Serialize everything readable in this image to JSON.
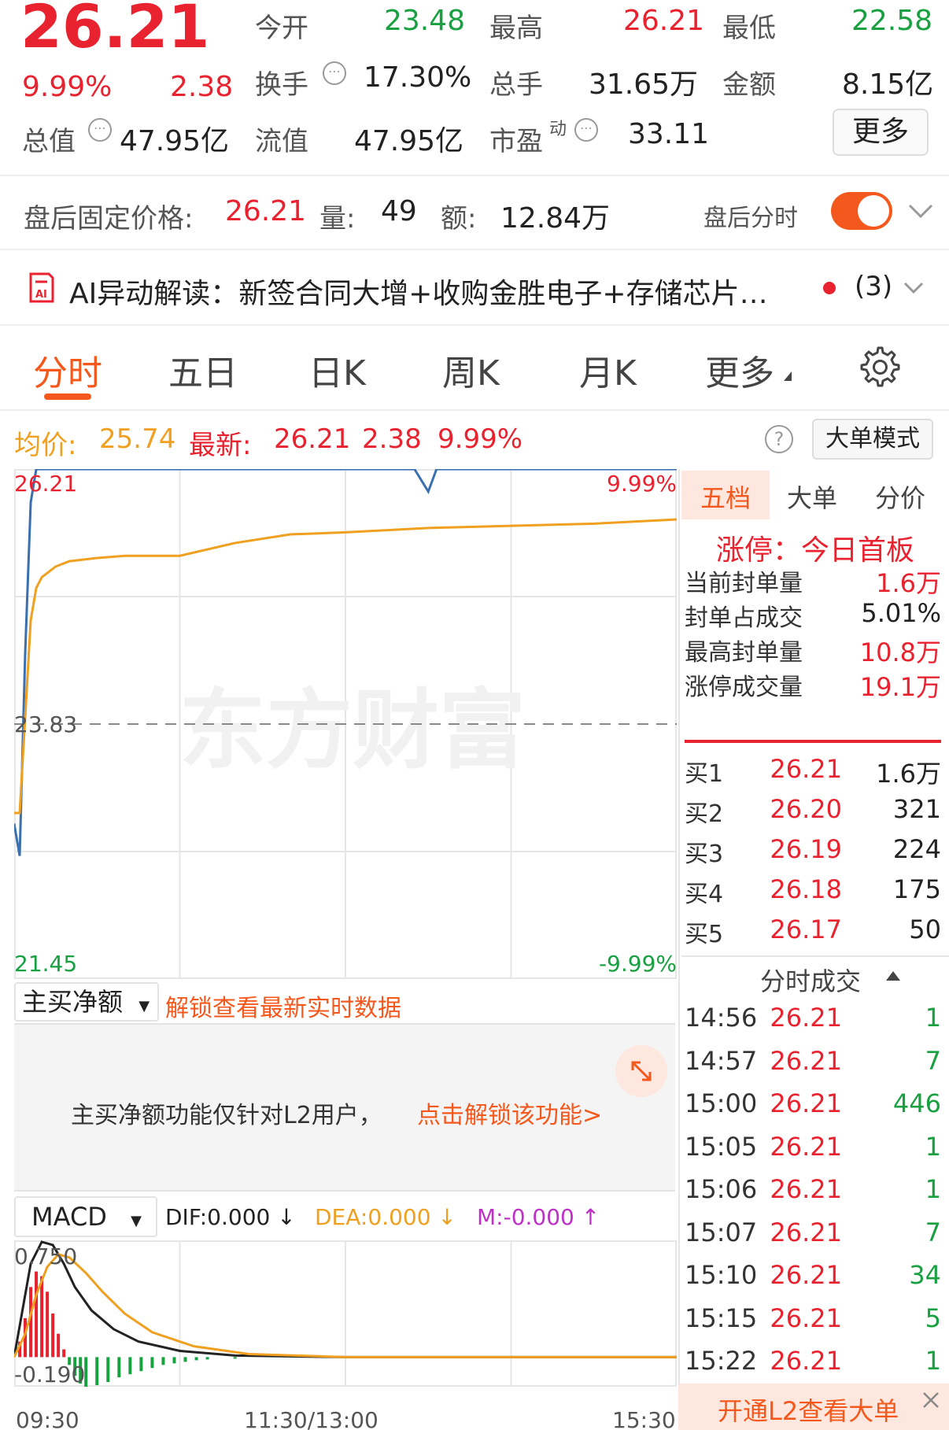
{
  "quote": {
    "price": "26.21",
    "change_pct": "9.99%",
    "change": "2.38",
    "open_label": "今开",
    "open": "23.48",
    "high_label": "最高",
    "high": "26.21",
    "low_label": "最低",
    "low": "22.58",
    "turnover_label": "换手",
    "turnover": "17.30%",
    "volume_label": "总手",
    "volume": "31.65万",
    "amount_label": "金额",
    "amount": "8.15亿",
    "total_cap_label": "总值",
    "total_cap": "47.95亿",
    "float_cap_label": "流值",
    "float_cap": "47.95亿",
    "pe_label": "市盈",
    "pe_sup": "动",
    "pe": "33.11",
    "more_label": "更多"
  },
  "after_hours": {
    "price_label": "盘后固定价格:",
    "price": "26.21",
    "vol_label": "量:",
    "vol": "49",
    "amt_label": "额:",
    "amt": "12.84万",
    "toggle_label": "盘后分时",
    "toggle_on": true
  },
  "ai": {
    "text": "AI异动解读：新签合同大增+收购金胜电子+存储芯片…",
    "count": "(3)"
  },
  "tabs": [
    "分时",
    "五日",
    "日K",
    "周K",
    "月K",
    "更多"
  ],
  "info_bar": {
    "avg_label": "均价:",
    "avg": "25.74",
    "latest_label": "最新:",
    "latest": "26.21",
    "change": "2.38",
    "change_pct": "9.99%",
    "help": "?",
    "mode_button": "大单模式"
  },
  "chart_labels": {
    "top_price": "26.21",
    "top_pct": "9.99%",
    "mid_price": "23.83",
    "bottom_price": "21.45",
    "bottom_pct": "-9.99%",
    "watermark": "东方财富"
  },
  "chart_data": [
    {
      "type": "line",
      "ylim": [
        21.45,
        26.21
      ],
      "reference": 23.83,
      "series": [
        {
          "color": "#3a6fb0",
          "x": [
            0,
            2,
            4,
            6,
            8,
            10,
            40,
            145,
            150,
            153,
            156,
            240
          ],
          "y": [
            22.9,
            22.6,
            24.5,
            25.9,
            26.21,
            26.21,
            26.21,
            26.21,
            26.0,
            26.21,
            26.21,
            26.21
          ]
        },
        {
          "color": "#f0a020",
          "x": [
            0,
            2,
            4,
            6,
            8,
            10,
            15,
            20,
            30,
            40,
            60,
            80,
            100,
            120,
            150,
            180,
            210,
            240
          ],
          "y": [
            23.0,
            23.0,
            23.9,
            24.8,
            25.1,
            25.2,
            25.3,
            25.35,
            25.38,
            25.4,
            25.4,
            25.52,
            25.6,
            25.62,
            25.66,
            25.68,
            25.7,
            25.74
          ]
        }
      ]
    },
    {
      "type": "line",
      "ylim": [
        -0.19,
        0.75
      ],
      "series": [
        {
          "name": "DIF",
          "color": "#222222",
          "x": [
            0,
            3,
            6,
            10,
            14,
            18,
            22,
            28,
            36,
            45,
            60,
            80,
            120,
            240
          ],
          "y": [
            0,
            0.3,
            0.6,
            0.74,
            0.72,
            0.6,
            0.45,
            0.3,
            0.18,
            0.1,
            0.04,
            0.01,
            0,
            0
          ]
        },
        {
          "name": "DEA",
          "color": "#f0a020",
          "x": [
            0,
            4,
            8,
            12,
            16,
            20,
            26,
            32,
            40,
            50,
            65,
            85,
            120,
            240
          ],
          "y": [
            0,
            0.15,
            0.4,
            0.58,
            0.66,
            0.64,
            0.54,
            0.42,
            0.28,
            0.16,
            0.07,
            0.02,
            0,
            0
          ]
        },
        {
          "name": "M",
          "type": "bar",
          "x": [
            2,
            4,
            6,
            8,
            10,
            12,
            14,
            16,
            18,
            20,
            22,
            24,
            26,
            30,
            34,
            38,
            42,
            46,
            50,
            54,
            58,
            62,
            66,
            70,
            80
          ],
          "y": [
            0.1,
            0.25,
            0.45,
            0.55,
            0.52,
            0.42,
            0.28,
            0.15,
            0.05,
            -0.05,
            -0.12,
            -0.17,
            -0.19,
            -0.18,
            -0.16,
            -0.13,
            -0.11,
            -0.09,
            -0.07,
            -0.05,
            -0.04,
            -0.03,
            -0.02,
            -0.015,
            -0.01
          ]
        }
      ]
    }
  ],
  "macd_labels": {
    "top": "0.750",
    "bottom": "-0.190",
    "select": "MACD",
    "dif": "DIF:0.000 ↓",
    "dea": "DEA:0.000 ↓",
    "m": "M:-0.000 ↑",
    "x_start": "09:30",
    "x_mid": "11:30/13:00",
    "x_end": "15:30"
  },
  "netbuy": {
    "select": "主买净额",
    "unlock_tip": "解锁查看最新实时数据",
    "msg": "主买净额功能仅针对L2用户，",
    "link": "点击解锁该功能>"
  },
  "side_tabs": [
    "五档",
    "大单",
    "分价"
  ],
  "limit_up": {
    "title": "涨停：今日首板",
    "rows": [
      {
        "label": "当前封单量",
        "value": "1.6万",
        "color": "#e8222e"
      },
      {
        "label": "封单占成交",
        "value": "5.01%",
        "color": "#222222"
      },
      {
        "label": "最高封单量",
        "value": "10.8万",
        "color": "#e8222e"
      },
      {
        "label": "涨停成交量",
        "value": "19.1万",
        "color": "#e8222e"
      }
    ]
  },
  "bids": [
    {
      "label": "买1",
      "price": "26.21",
      "vol": "1.6万"
    },
    {
      "label": "买2",
      "price": "26.20",
      "vol": "321"
    },
    {
      "label": "买3",
      "price": "26.19",
      "vol": "224"
    },
    {
      "label": "买4",
      "price": "26.18",
      "vol": "175"
    },
    {
      "label": "买5",
      "price": "26.17",
      "vol": "50"
    }
  ],
  "ticks_title": "分时成交",
  "ticks": [
    {
      "time": "14:56",
      "price": "26.21",
      "vol": "1",
      "color": "#18a041"
    },
    {
      "time": "14:57",
      "price": "26.21",
      "vol": "7",
      "color": "#18a041"
    },
    {
      "time": "15:00",
      "price": "26.21",
      "vol": "446",
      "color": "#18a041"
    },
    {
      "time": "15:05",
      "price": "26.21",
      "vol": "1",
      "color": "#18a041"
    },
    {
      "time": "15:06",
      "price": "26.21",
      "vol": "1",
      "color": "#18a041"
    },
    {
      "time": "15:07",
      "price": "26.21",
      "vol": "7",
      "color": "#18a041"
    },
    {
      "time": "15:10",
      "price": "26.21",
      "vol": "34",
      "color": "#18a041"
    },
    {
      "time": "15:15",
      "price": "26.21",
      "vol": "5",
      "color": "#18a041"
    },
    {
      "time": "15:22",
      "price": "26.21",
      "vol": "1",
      "color": "#18a041"
    }
  ],
  "l2_banner": "开通L2查看大单",
  "colors": {
    "up": "#e8222e",
    "down": "#18a041",
    "accent": "#f5581c",
    "avg": "#f0a020",
    "price_line": "#3a6fb0"
  }
}
